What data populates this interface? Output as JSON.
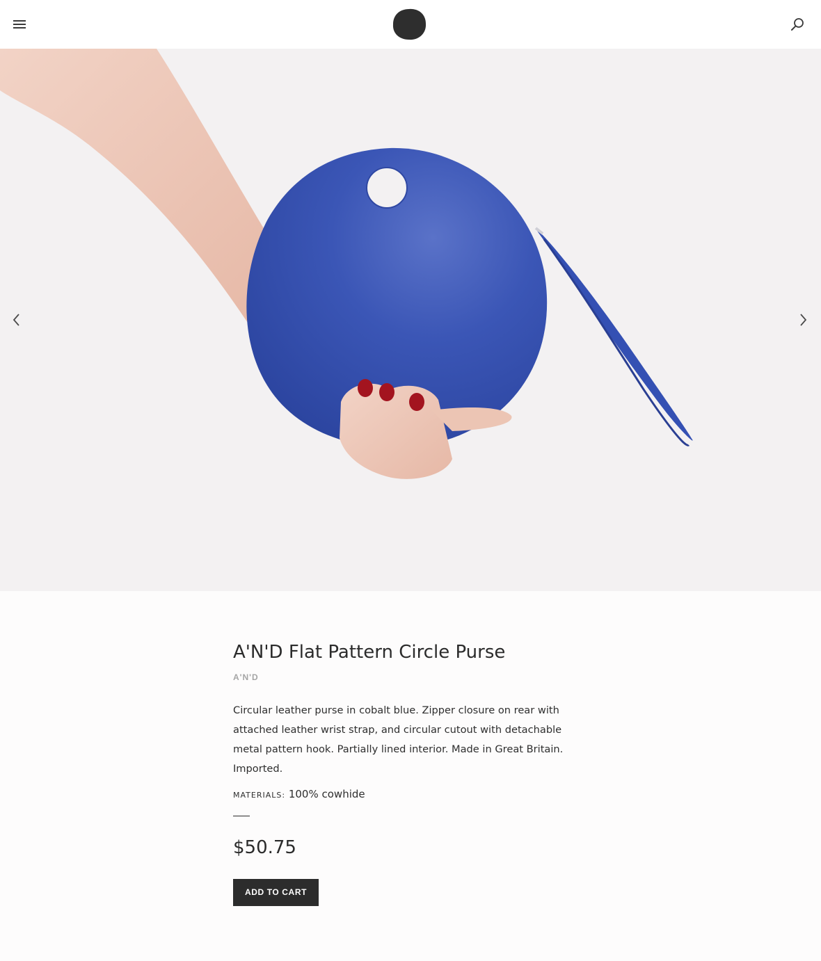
{
  "header": {
    "logo_alt": "",
    "menu_icon": "hamburger-menu-icon",
    "search_icon": "search-icon"
  },
  "gallery": {
    "image_alt": "",
    "prev_icon": "chevron-left-icon",
    "next_icon": "chevron-right-icon"
  },
  "product": {
    "title": "A'N'D Flat Pattern Circle Purse",
    "vendor": "A'N'D",
    "description": "Circular leather purse in cobalt blue. Zipper closure on rear with attached leather wrist strap, and circular cutout with detachable metal pattern hook. Partially lined interior. Made in Great Britain. Imported.",
    "materials_label": "MATERIALS:",
    "materials_value": "100% cowhide",
    "price": "$50.75",
    "add_to_cart_label": "ADD TO CART"
  },
  "colors": {
    "hero_bg": "#f3f1f2",
    "button_bg": "#2c2c2c",
    "vendor_text": "#a5a5a5",
    "purse_blue": "#3a56b8"
  }
}
